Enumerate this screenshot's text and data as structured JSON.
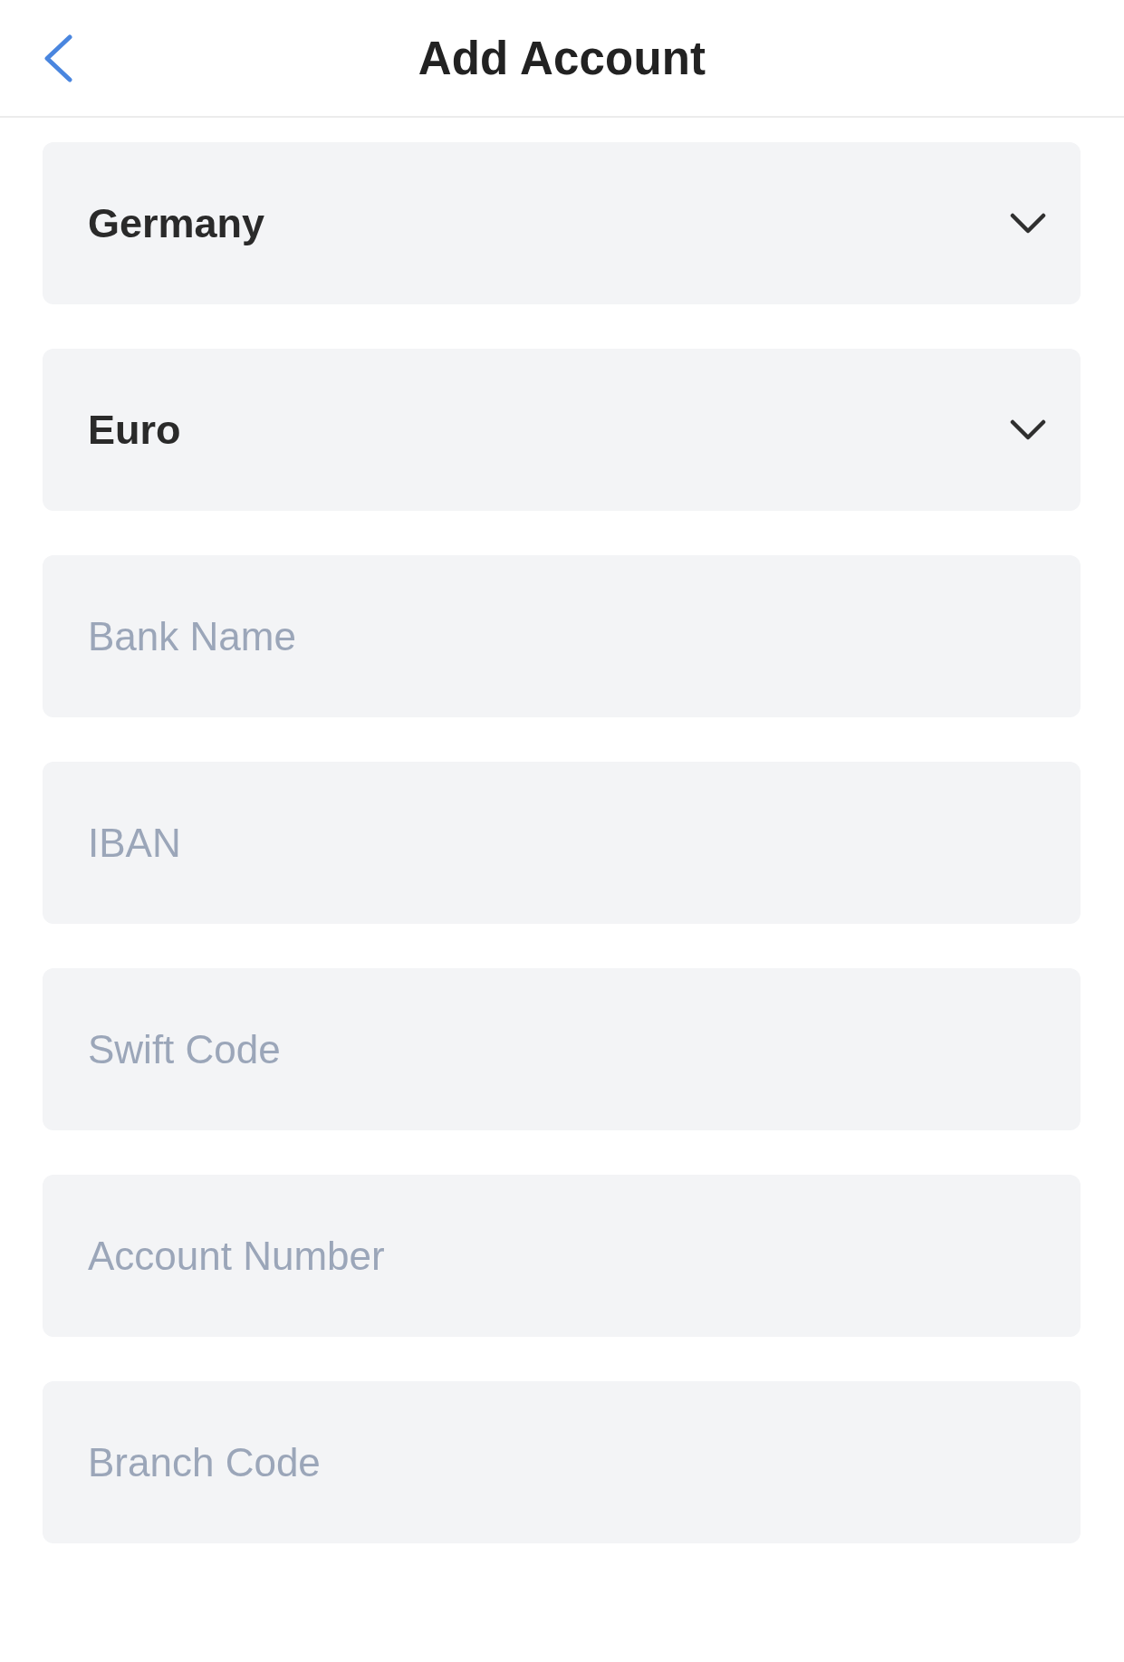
{
  "header": {
    "title": "Add Account"
  },
  "fields": [
    {
      "kind": "select",
      "value": "Germany"
    },
    {
      "kind": "select",
      "value": "Euro"
    },
    {
      "kind": "input",
      "placeholder": "Bank Name"
    },
    {
      "kind": "input",
      "placeholder": "IBAN"
    },
    {
      "kind": "input",
      "placeholder": "Swift Code"
    },
    {
      "kind": "input",
      "placeholder": "Account Number"
    },
    {
      "kind": "input",
      "placeholder": "Branch Code"
    }
  ]
}
